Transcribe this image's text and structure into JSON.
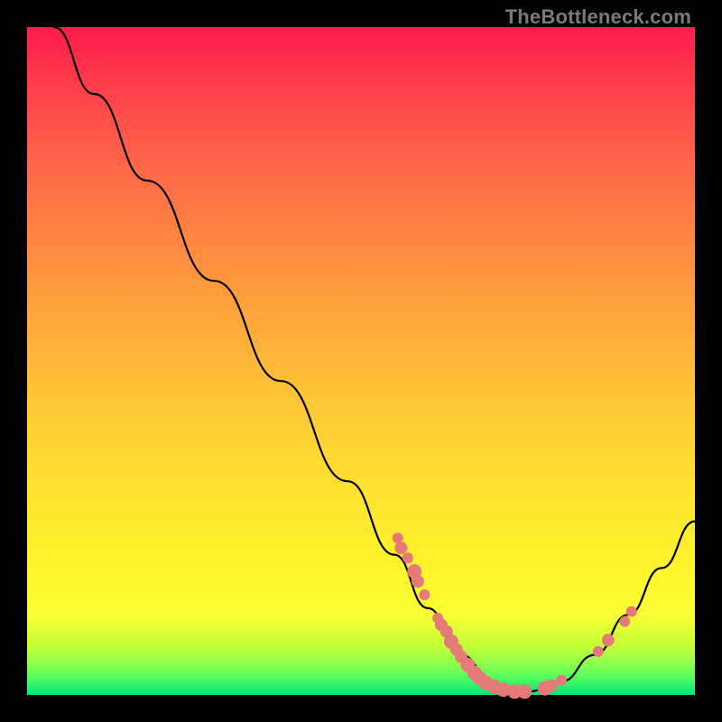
{
  "watermark": "TheBottleneck.com",
  "chart_data": {
    "type": "line",
    "title": "",
    "xlabel": "",
    "ylabel": "",
    "xlim": [
      0,
      100
    ],
    "ylim": [
      0,
      100
    ],
    "curve": [
      {
        "x": 4,
        "y": 100
      },
      {
        "x": 10,
        "y": 90
      },
      {
        "x": 18,
        "y": 77
      },
      {
        "x": 28,
        "y": 62
      },
      {
        "x": 38,
        "y": 47
      },
      {
        "x": 48,
        "y": 32
      },
      {
        "x": 55,
        "y": 21
      },
      {
        "x": 60,
        "y": 13
      },
      {
        "x": 65,
        "y": 6
      },
      {
        "x": 70,
        "y": 1.5
      },
      {
        "x": 75,
        "y": 0.5
      },
      {
        "x": 80,
        "y": 2
      },
      {
        "x": 85,
        "y": 6
      },
      {
        "x": 90,
        "y": 12
      },
      {
        "x": 95,
        "y": 19
      },
      {
        "x": 100,
        "y": 26
      }
    ],
    "markers": [
      {
        "x": 55.5,
        "y": 23.5,
        "r": 6
      },
      {
        "x": 56.0,
        "y": 22.0,
        "r": 7
      },
      {
        "x": 57.0,
        "y": 20.5,
        "r": 6
      },
      {
        "x": 58.0,
        "y": 18.5,
        "r": 8
      },
      {
        "x": 58.5,
        "y": 17.0,
        "r": 7
      },
      {
        "x": 59.5,
        "y": 15.0,
        "r": 6
      },
      {
        "x": 61.5,
        "y": 11.5,
        "r": 6
      },
      {
        "x": 62.0,
        "y": 10.5,
        "r": 7
      },
      {
        "x": 62.8,
        "y": 9.5,
        "r": 7
      },
      {
        "x": 63.5,
        "y": 8.0,
        "r": 8
      },
      {
        "x": 64.3,
        "y": 6.8,
        "r": 7
      },
      {
        "x": 65.0,
        "y": 5.7,
        "r": 7
      },
      {
        "x": 66.0,
        "y": 4.5,
        "r": 8
      },
      {
        "x": 67.0,
        "y": 3.3,
        "r": 8
      },
      {
        "x": 67.8,
        "y": 2.5,
        "r": 8
      },
      {
        "x": 68.7,
        "y": 1.8,
        "r": 8
      },
      {
        "x": 70.0,
        "y": 1.2,
        "r": 8
      },
      {
        "x": 71.3,
        "y": 0.8,
        "r": 8
      },
      {
        "x": 73.0,
        "y": 0.5,
        "r": 8
      },
      {
        "x": 74.5,
        "y": 0.5,
        "r": 8
      },
      {
        "x": 77.5,
        "y": 1.0,
        "r": 8
      },
      {
        "x": 78.5,
        "y": 1.4,
        "r": 7
      },
      {
        "x": 80.0,
        "y": 2.2,
        "r": 6
      },
      {
        "x": 85.5,
        "y": 6.5,
        "r": 6
      },
      {
        "x": 87.0,
        "y": 8.2,
        "r": 7
      },
      {
        "x": 89.5,
        "y": 11.0,
        "r": 6
      },
      {
        "x": 90.5,
        "y": 12.5,
        "r": 6
      }
    ],
    "gradient_note": "background gradient red→orange→yellow→green top→bottom"
  }
}
